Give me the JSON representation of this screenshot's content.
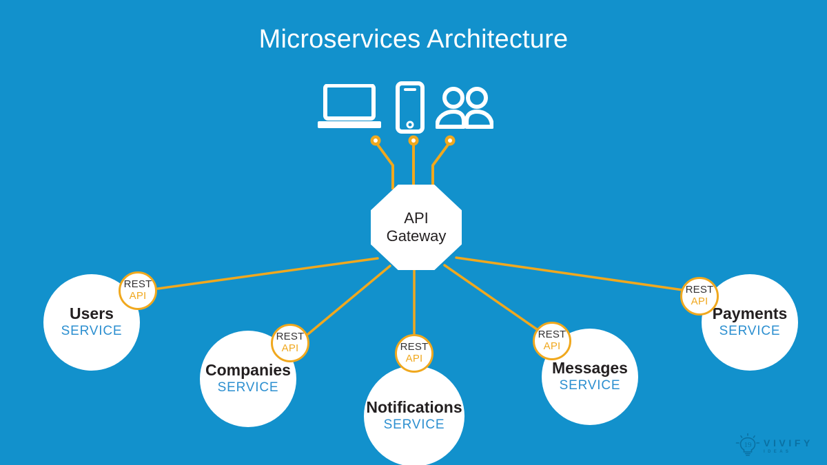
{
  "page": {
    "title": "Microservices Architecture",
    "background_color": "#1291CC",
    "accent_color": "#F0A81E",
    "service_label_color": "#2c8fd0",
    "text_color": "#231f20"
  },
  "clients": [
    {
      "name": "laptop-client",
      "icon": "laptop-icon"
    },
    {
      "name": "mobile-client",
      "icon": "mobile-phone-icon"
    },
    {
      "name": "users-client",
      "icon": "people-icon"
    }
  ],
  "gateway": {
    "line1": "API",
    "line2": "Gateway"
  },
  "badge": {
    "rest": "REST",
    "api": "API"
  },
  "services": [
    {
      "name": "Users",
      "sub": "SERVICE"
    },
    {
      "name": "Companies",
      "sub": "SERVICE"
    },
    {
      "name": "Notifications",
      "sub": "SERVICE"
    },
    {
      "name": "Messages",
      "sub": "SERVICE"
    },
    {
      "name": "Payments",
      "sub": "SERVICE"
    }
  ],
  "logo": {
    "main": "VIVIFY",
    "sub": "IDEAS",
    "icon": "lightbulb-icon"
  }
}
